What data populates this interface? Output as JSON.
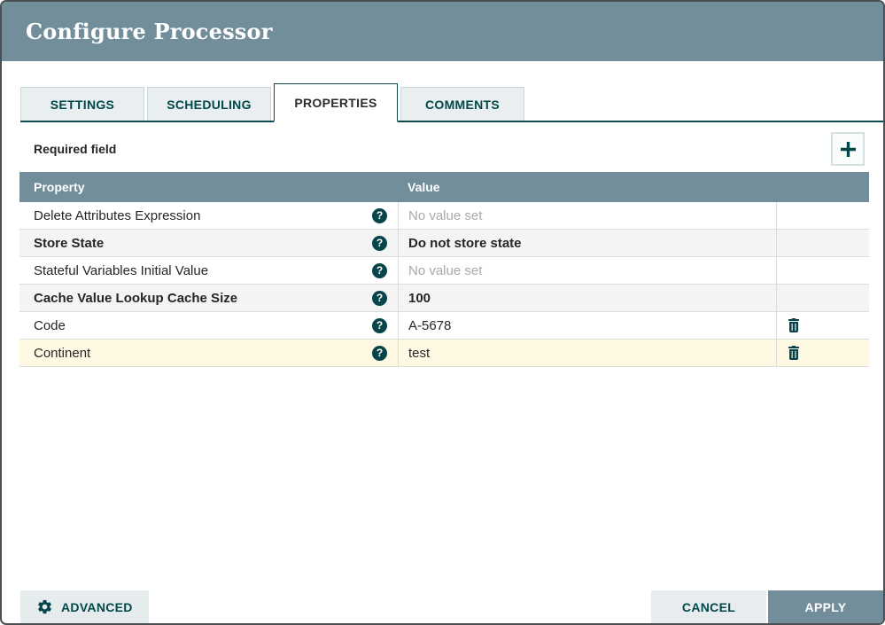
{
  "dialog": {
    "title": "Configure Processor"
  },
  "tabs": [
    {
      "label": "SETTINGS",
      "active": false
    },
    {
      "label": "SCHEDULING",
      "active": false
    },
    {
      "label": "PROPERTIES",
      "active": true
    },
    {
      "label": "COMMENTS",
      "active": false
    }
  ],
  "properties_tab": {
    "required_field_label": "Required field"
  },
  "table": {
    "columns": [
      "Property",
      "Value"
    ],
    "rows": [
      {
        "property": "Delete Attributes Expression",
        "value": "No value set",
        "required": false,
        "value_unset": true,
        "deletable": false,
        "highlighted": false
      },
      {
        "property": "Store State",
        "value": "Do not store state",
        "required": true,
        "value_unset": false,
        "deletable": false,
        "highlighted": false
      },
      {
        "property": "Stateful Variables Initial Value",
        "value": "No value set",
        "required": false,
        "value_unset": true,
        "deletable": false,
        "highlighted": false
      },
      {
        "property": "Cache Value Lookup Cache Size",
        "value": "100",
        "required": true,
        "value_unset": false,
        "deletable": false,
        "highlighted": false
      },
      {
        "property": "Code",
        "value": "A-5678",
        "required": false,
        "value_unset": false,
        "deletable": true,
        "highlighted": false
      },
      {
        "property": "Continent",
        "value": "test",
        "required": false,
        "value_unset": false,
        "deletable": true,
        "highlighted": true
      }
    ]
  },
  "footer": {
    "advanced_label": "ADVANCED",
    "cancel_label": "CANCEL",
    "apply_label": "APPLY"
  },
  "icons": {
    "help_glyph": "?",
    "plus": "plus-icon",
    "gear": "gear-icon",
    "trash": "trash-icon"
  },
  "colors": {
    "header_bg": "#728E9B",
    "accent_teal": "#004849",
    "tab_inactive_bg": "#E9EEF0",
    "row_alt_bg": "#F4F4F4",
    "row_highlight_bg": "#FFF8E3",
    "unset_value_text": "#A9A9A9",
    "button_bg": "#E8ECEE",
    "apply_bg": "#728E9B"
  }
}
